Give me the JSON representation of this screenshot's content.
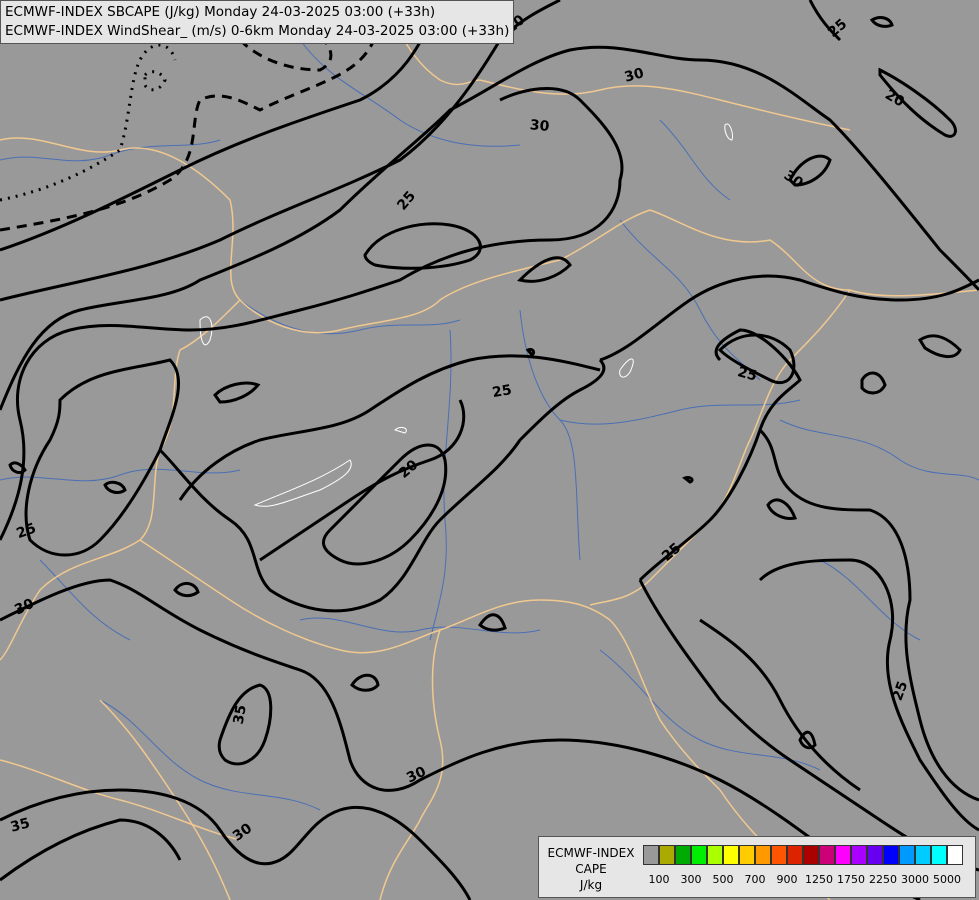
{
  "header": {
    "line1": "ECMWF-INDEX SBCAPE (J/kg) Monday 24-03-2025 03:00 (+33h)",
    "line2": "ECMWF-INDEX WindShear_ (m/s) 0-6km Monday 24-03-2025 03:00 (+33h)"
  },
  "contour_labels": [
    "20",
    "25",
    "30",
    "30",
    "20",
    "25",
    "30",
    "25",
    "25",
    "20",
    "25",
    "30",
    "25",
    "25",
    "35",
    "30",
    "35",
    "30"
  ],
  "legend": {
    "line1": "ECMWF-INDEX",
    "line2": "CAPE",
    "line3": "J/kg",
    "colors": [
      "#999999",
      "#aaaa00",
      "#00aa00",
      "#00ee00",
      "#aaff00",
      "#ffff00",
      "#ffcc00",
      "#ff9900",
      "#ff5500",
      "#dd2200",
      "#aa0000",
      "#cc0077",
      "#ff00ff",
      "#aa00ff",
      "#6600ee",
      "#0000ff",
      "#0099ff",
      "#00ccff",
      "#00ffff",
      "#ffffff"
    ],
    "ticks": [
      "100",
      "300",
      "500",
      "700",
      "900",
      "1250",
      "1750",
      "2250",
      "3000",
      "5000"
    ]
  }
}
